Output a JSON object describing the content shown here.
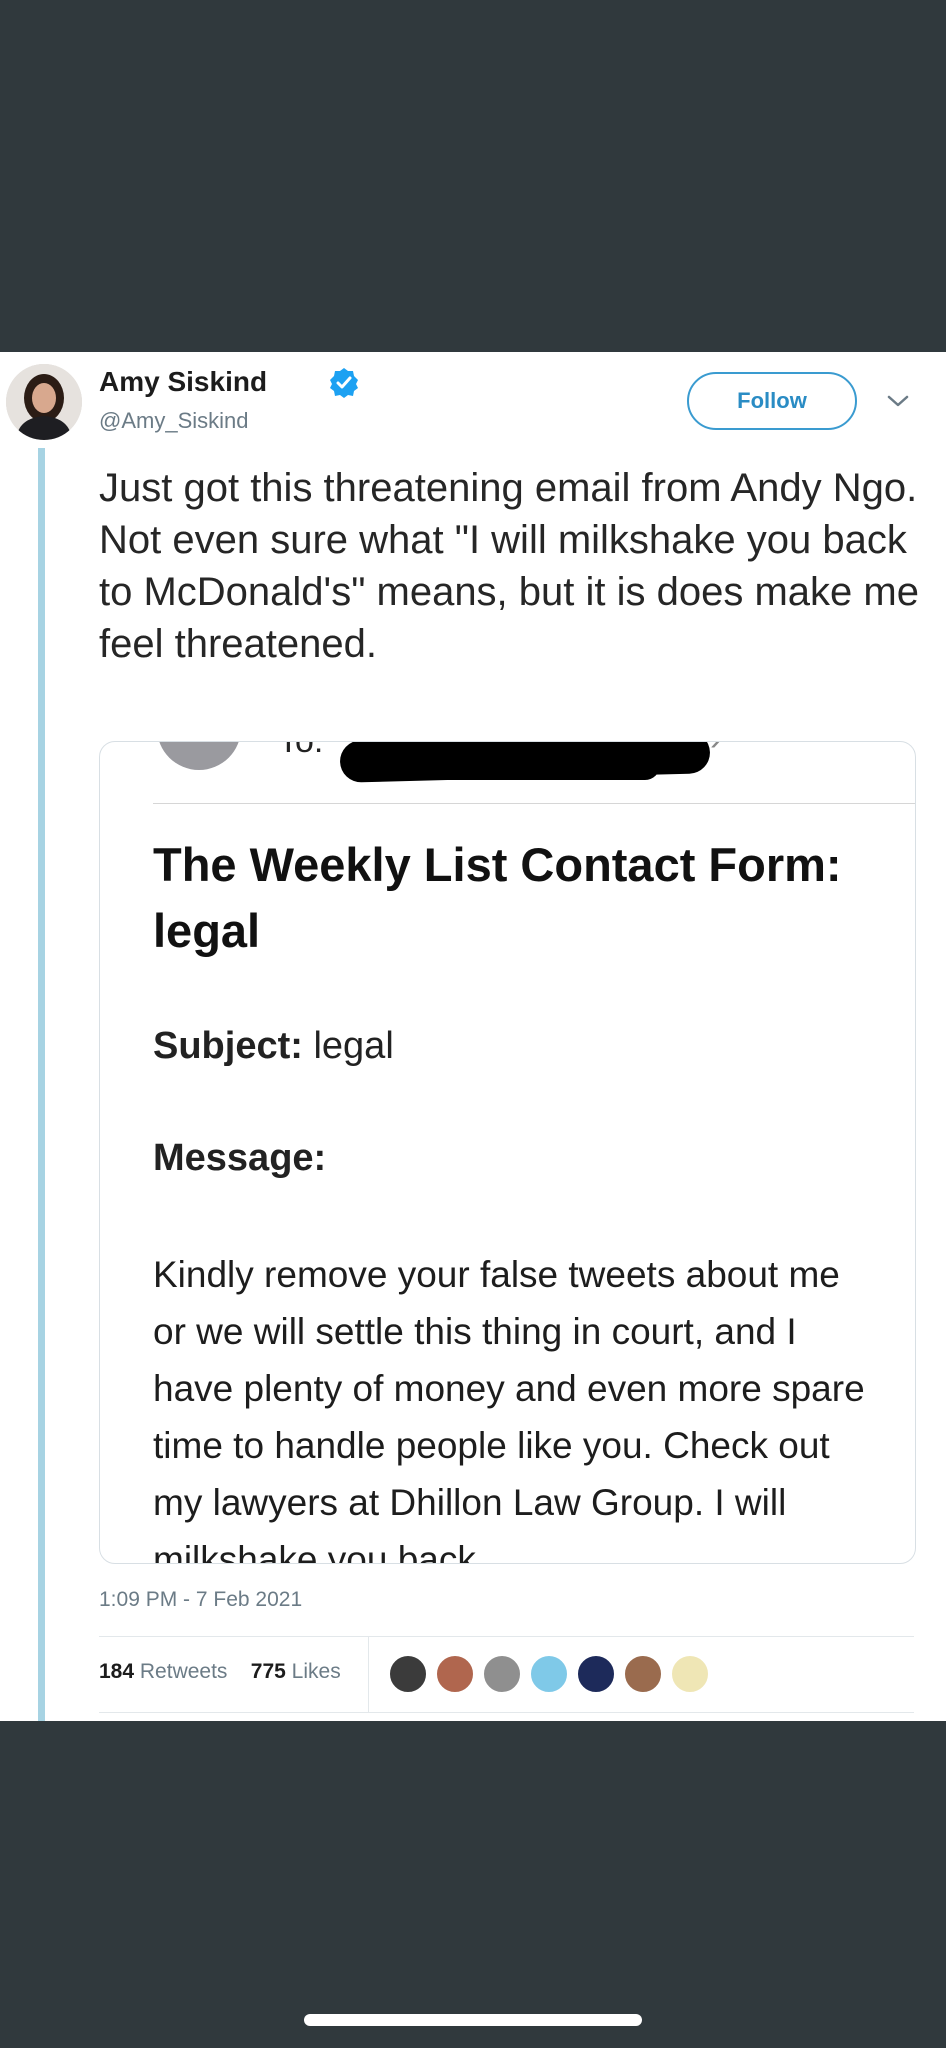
{
  "tweet": {
    "author_name": "Amy Siskind",
    "author_handle": "@Amy_Siskind",
    "follow_label": "Follow",
    "text": "Just got this threatening email from Andy Ngo. Not even sure what \"I will milkshake you back to McDonald's\" means, but it is does make me feel threatened.",
    "timestamp": "1:09 PM - 7 Feb 2021",
    "retweets_count": "184",
    "retweets_label": "Retweets",
    "likes_count": "775",
    "likes_label": "Likes"
  },
  "email_card": {
    "to_label": "To:",
    "title": "The Weekly List Contact Form: legal",
    "subject_label": "Subject:",
    "subject_value": "legal",
    "message_label": "Message:",
    "body": "Kindly remove your false tweets about me or we will settle this thing in court, and I have plenty of money and even more spare time to handle people like you. Check out my lawyers at Dhillon Law Group. I will milkshake you back"
  },
  "colors": {
    "background": "#30393d",
    "accent": "#2a8cc4",
    "verified": "#1da1f2",
    "thread_line": "#a7d3e3"
  },
  "icons": {
    "verified": "verified-badge-icon",
    "chevron": "chevron-down-icon"
  },
  "liker_avatars": [
    {
      "color": "#3b3b3b"
    },
    {
      "color": "#b0664e"
    },
    {
      "color": "#8f8f8f"
    },
    {
      "color": "#7fc9e8"
    },
    {
      "color": "#1d2a5a"
    },
    {
      "color": "#9a6b4e"
    },
    {
      "color": "#efe6b5"
    }
  ]
}
